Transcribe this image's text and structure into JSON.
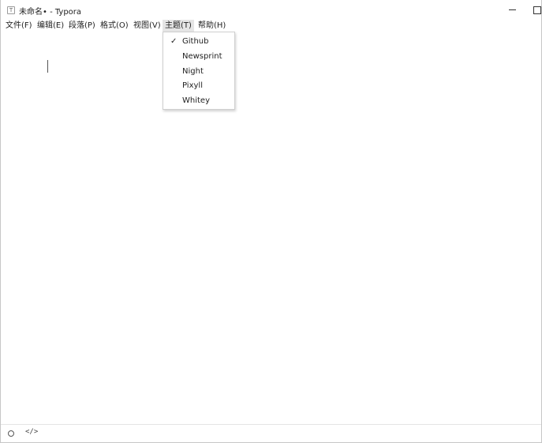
{
  "window": {
    "app_icon_glyph": "T",
    "title": "未命名• - Typora"
  },
  "menubar": {
    "items": [
      {
        "label": "文件(F)"
      },
      {
        "label": "编辑(E)"
      },
      {
        "label": "段落(P)"
      },
      {
        "label": "格式(O)"
      },
      {
        "label": "视图(V)"
      },
      {
        "label": "主题(T)",
        "active": true
      },
      {
        "label": "帮助(H)"
      }
    ]
  },
  "theme_menu": {
    "items": [
      {
        "label": "Github",
        "checked": true
      },
      {
        "label": "Newsprint",
        "checked": false
      },
      {
        "label": "Night",
        "checked": false
      },
      {
        "label": "Pixyll",
        "checked": false
      },
      {
        "label": "Whitey",
        "checked": false
      }
    ],
    "check_glyph": "✓"
  },
  "statusbar": {
    "source_toggle_glyph": "</>"
  },
  "icons": {
    "app": "typora-app-icon",
    "minimize": "minimize-icon",
    "maximize": "maximize-icon",
    "check": "check-icon",
    "outline": "circle-icon",
    "source": "code-icon"
  }
}
